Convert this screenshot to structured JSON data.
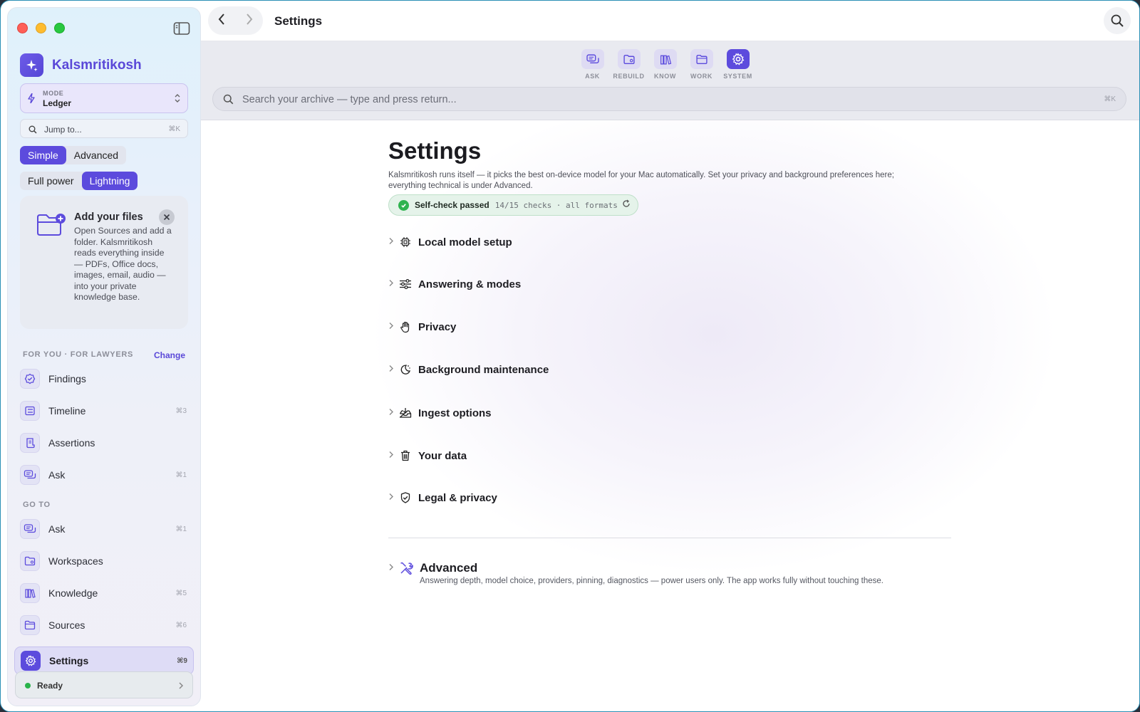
{
  "app": {
    "name": "Kalsmritikosh"
  },
  "titlebar": {
    "title": "Settings"
  },
  "mode": {
    "label": "MODE",
    "value": "Ledger"
  },
  "jump": {
    "placeholder": "Jump to...",
    "shortcut": "⌘K"
  },
  "segments": {
    "level": {
      "options": [
        "Simple",
        "Advanced"
      ],
      "selected": "Simple"
    },
    "power": {
      "options": [
        "Full power",
        "Lightning"
      ],
      "selected": "Lightning"
    }
  },
  "onboarding": {
    "title": "Add your files",
    "body": "Open Sources and add a folder. Kalsmritikosh reads everything inside — PDFs, Office docs, images, email, audio — into your private knowledge base."
  },
  "for_you": {
    "label": "FOR YOU · FOR LAWYERS",
    "change": "Change",
    "items": [
      {
        "label": "Findings",
        "shortcut": "",
        "icon": "badge-check-icon"
      },
      {
        "label": "Timeline",
        "shortcut": "⌘3",
        "icon": "timeline-icon"
      },
      {
        "label": "Assertions",
        "shortcut": "",
        "icon": "scroll-icon"
      },
      {
        "label": "Ask",
        "shortcut": "⌘1",
        "icon": "chat-icon"
      }
    ]
  },
  "go_to": {
    "label": "GO TO",
    "items": [
      {
        "label": "Ask",
        "shortcut": "⌘1",
        "icon": "chat-icon"
      },
      {
        "label": "Workspaces",
        "shortcut": "",
        "icon": "folder-gear-icon"
      },
      {
        "label": "Knowledge",
        "shortcut": "⌘5",
        "icon": "books-icon"
      },
      {
        "label": "Sources",
        "shortcut": "⌘6",
        "icon": "folder-icon"
      },
      {
        "label": "Settings",
        "shortcut": "⌘9",
        "icon": "gear-icon",
        "active": true
      }
    ]
  },
  "status": {
    "text": "Ready",
    "color": "#29b34a"
  },
  "toolbar": {
    "tools": [
      {
        "label": "ASK",
        "icon": "chat-icon"
      },
      {
        "label": "REBUILD",
        "icon": "folder-gear-icon"
      },
      {
        "label": "KNOW",
        "icon": "books-icon"
      },
      {
        "label": "WORK",
        "icon": "folder-icon"
      },
      {
        "label": "SYSTEM",
        "icon": "gear-icon",
        "active": true
      }
    ],
    "search_placeholder": "Search your archive — type and press return...",
    "search_shortcut": "⌘K"
  },
  "settings": {
    "heading": "Settings",
    "description": "Kalsmritikosh runs itself — it picks the best on-device model for your Mac automatically. Set your privacy and background preferences here; everything technical is under Advanced.",
    "selfcheck": {
      "label": "Self-check passed",
      "meta": "14/15 checks · all formats"
    },
    "sections": [
      {
        "label": "Local model setup",
        "icon": "chip-icon"
      },
      {
        "label": "Answering & modes",
        "icon": "sliders-icon"
      },
      {
        "label": "Privacy",
        "icon": "hand-icon"
      },
      {
        "label": "Background maintenance",
        "icon": "moon-icon"
      },
      {
        "label": "Ingest options",
        "icon": "tray-in-icon"
      },
      {
        "label": "Your data",
        "icon": "trash-icon"
      },
      {
        "label": "Legal & privacy",
        "icon": "shield-check-icon"
      }
    ],
    "advanced": {
      "label": "Advanced",
      "description": "Answering depth, model choice, providers, pinning, diagnostics — power users only. The app works fully without touching these."
    }
  },
  "colors": {
    "accent": "#5c4bdd",
    "brand_text": "#5a48d8",
    "success": "#2fb34f"
  }
}
